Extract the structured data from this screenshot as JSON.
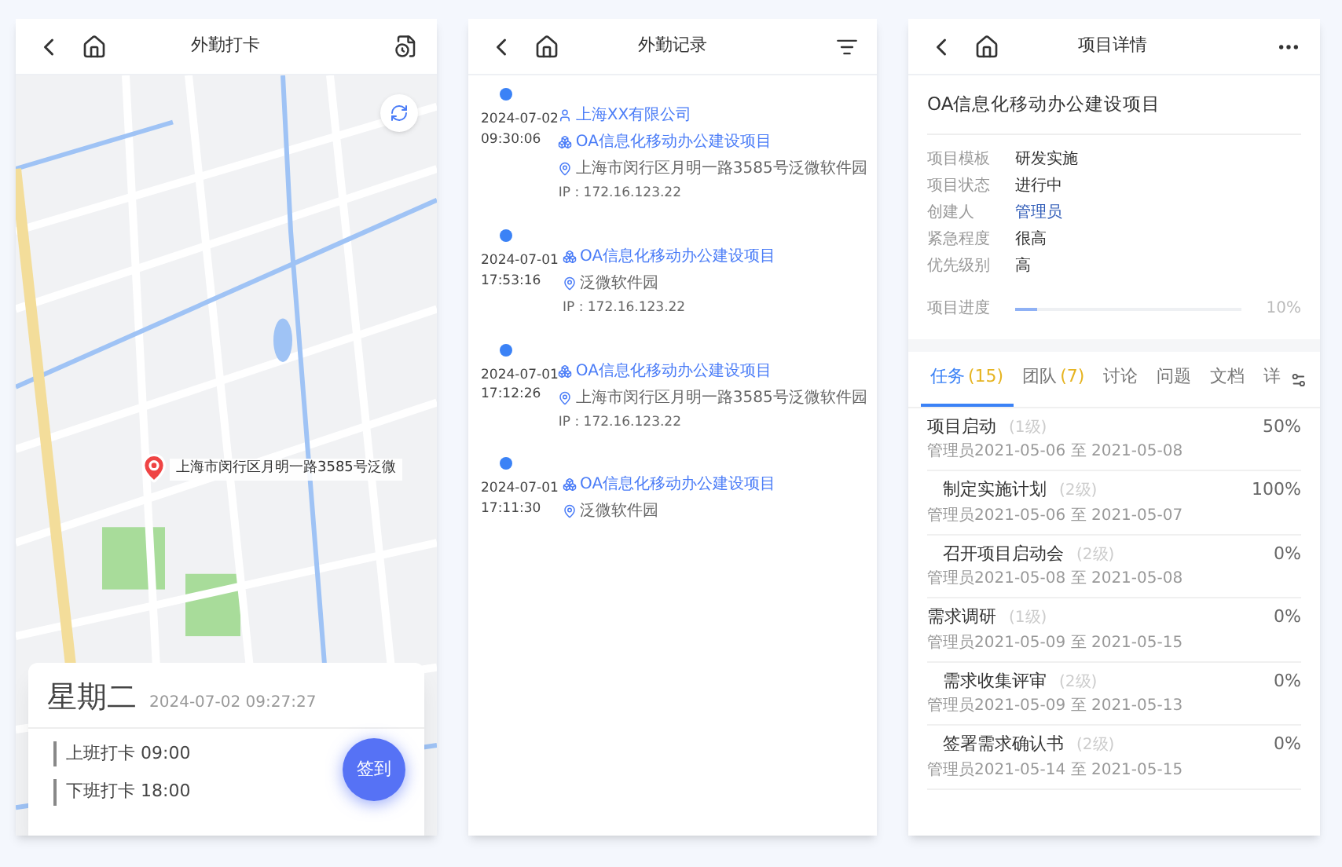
{
  "checkin": {
    "title": "外勤打卡",
    "location_label": "上海市闵行区月明一路3585号泛微",
    "card": {
      "day": "星期二",
      "datetime": "2024-07-02 09:27:27",
      "shifts": [
        {
          "label": "上班打卡 09:00"
        },
        {
          "label": "下班打卡 18:00"
        }
      ],
      "button": "签到"
    }
  },
  "records": {
    "title": "外勤记录",
    "items": [
      {
        "date": "2024-07-02",
        "time": "09:30:06",
        "company": "上海XX有限公司",
        "project": "OA信息化移动办公建设项目",
        "location": "上海市闵行区月明一路3585号泛微软件园",
        "ip": "IP : 172.16.123.22"
      },
      {
        "date": "2024-07-01",
        "time": "17:53:16",
        "project": "OA信息化移动办公建设项目",
        "location": "泛微软件园",
        "ip": "IP : 172.16.123.22"
      },
      {
        "date": "2024-07-01",
        "time": "17:12:26",
        "project": "OA信息化移动办公建设项目",
        "location": "上海市闵行区月明一路3585号泛微软件园",
        "ip": "IP : 172.16.123.22"
      },
      {
        "date": "2024-07-01",
        "time": "17:11:30",
        "project": "OA信息化移动办公建设项目",
        "location": "泛微软件园"
      }
    ]
  },
  "project": {
    "title": "项目详情",
    "name": "OA信息化移动办公建设项目",
    "fields": [
      {
        "label": "项目模板",
        "value": "研发实施",
        "kind": "text"
      },
      {
        "label": "项目状态",
        "value": "进行中",
        "kind": "text"
      },
      {
        "label": "创建人",
        "value": "管理员",
        "kind": "link"
      },
      {
        "label": "紧急程度",
        "value": "很高",
        "kind": "text"
      },
      {
        "label": "优先级别",
        "value": "高",
        "kind": "text"
      }
    ],
    "progress": {
      "label": "项目进度",
      "level": 0.1,
      "reading": "10%"
    },
    "tabs": [
      {
        "label": "任务",
        "count": "(15)",
        "selected": true
      },
      {
        "label": "团队",
        "count": "(7)",
        "selected": false
      },
      {
        "label": "讨论",
        "selected": false
      },
      {
        "label": "问题",
        "selected": false
      },
      {
        "label": "文档",
        "selected": false
      },
      {
        "label": "详",
        "selected": false
      }
    ],
    "tasks": [
      {
        "name": "项目启动",
        "grade": "(1级)",
        "meta": "管理员2021-05-06 至 2021-05-08",
        "percent": "50%",
        "children": [
          {
            "name": "制定实施计划",
            "grade": "(2级)",
            "meta": "管理员2021-05-06 至 2021-05-07",
            "percent": "100%"
          },
          {
            "name": "召开项目启动会",
            "grade": "(2级)",
            "meta": "管理员2021-05-08 至 2021-05-08",
            "percent": "0%"
          }
        ]
      },
      {
        "name": "需求调研",
        "grade": "(1级)",
        "meta": "管理员2021-05-09 至 2021-05-15",
        "percent": "0%",
        "children": [
          {
            "name": "需求收集评审",
            "grade": "(2级)",
            "meta": "管理员2021-05-09 至 2021-05-13",
            "percent": "0%"
          },
          {
            "name": "签署需求确认书",
            "grade": "(2级)",
            "meta": "管理员2021-05-14 至 2021-05-15",
            "percent": "0%"
          }
        ]
      }
    ]
  }
}
